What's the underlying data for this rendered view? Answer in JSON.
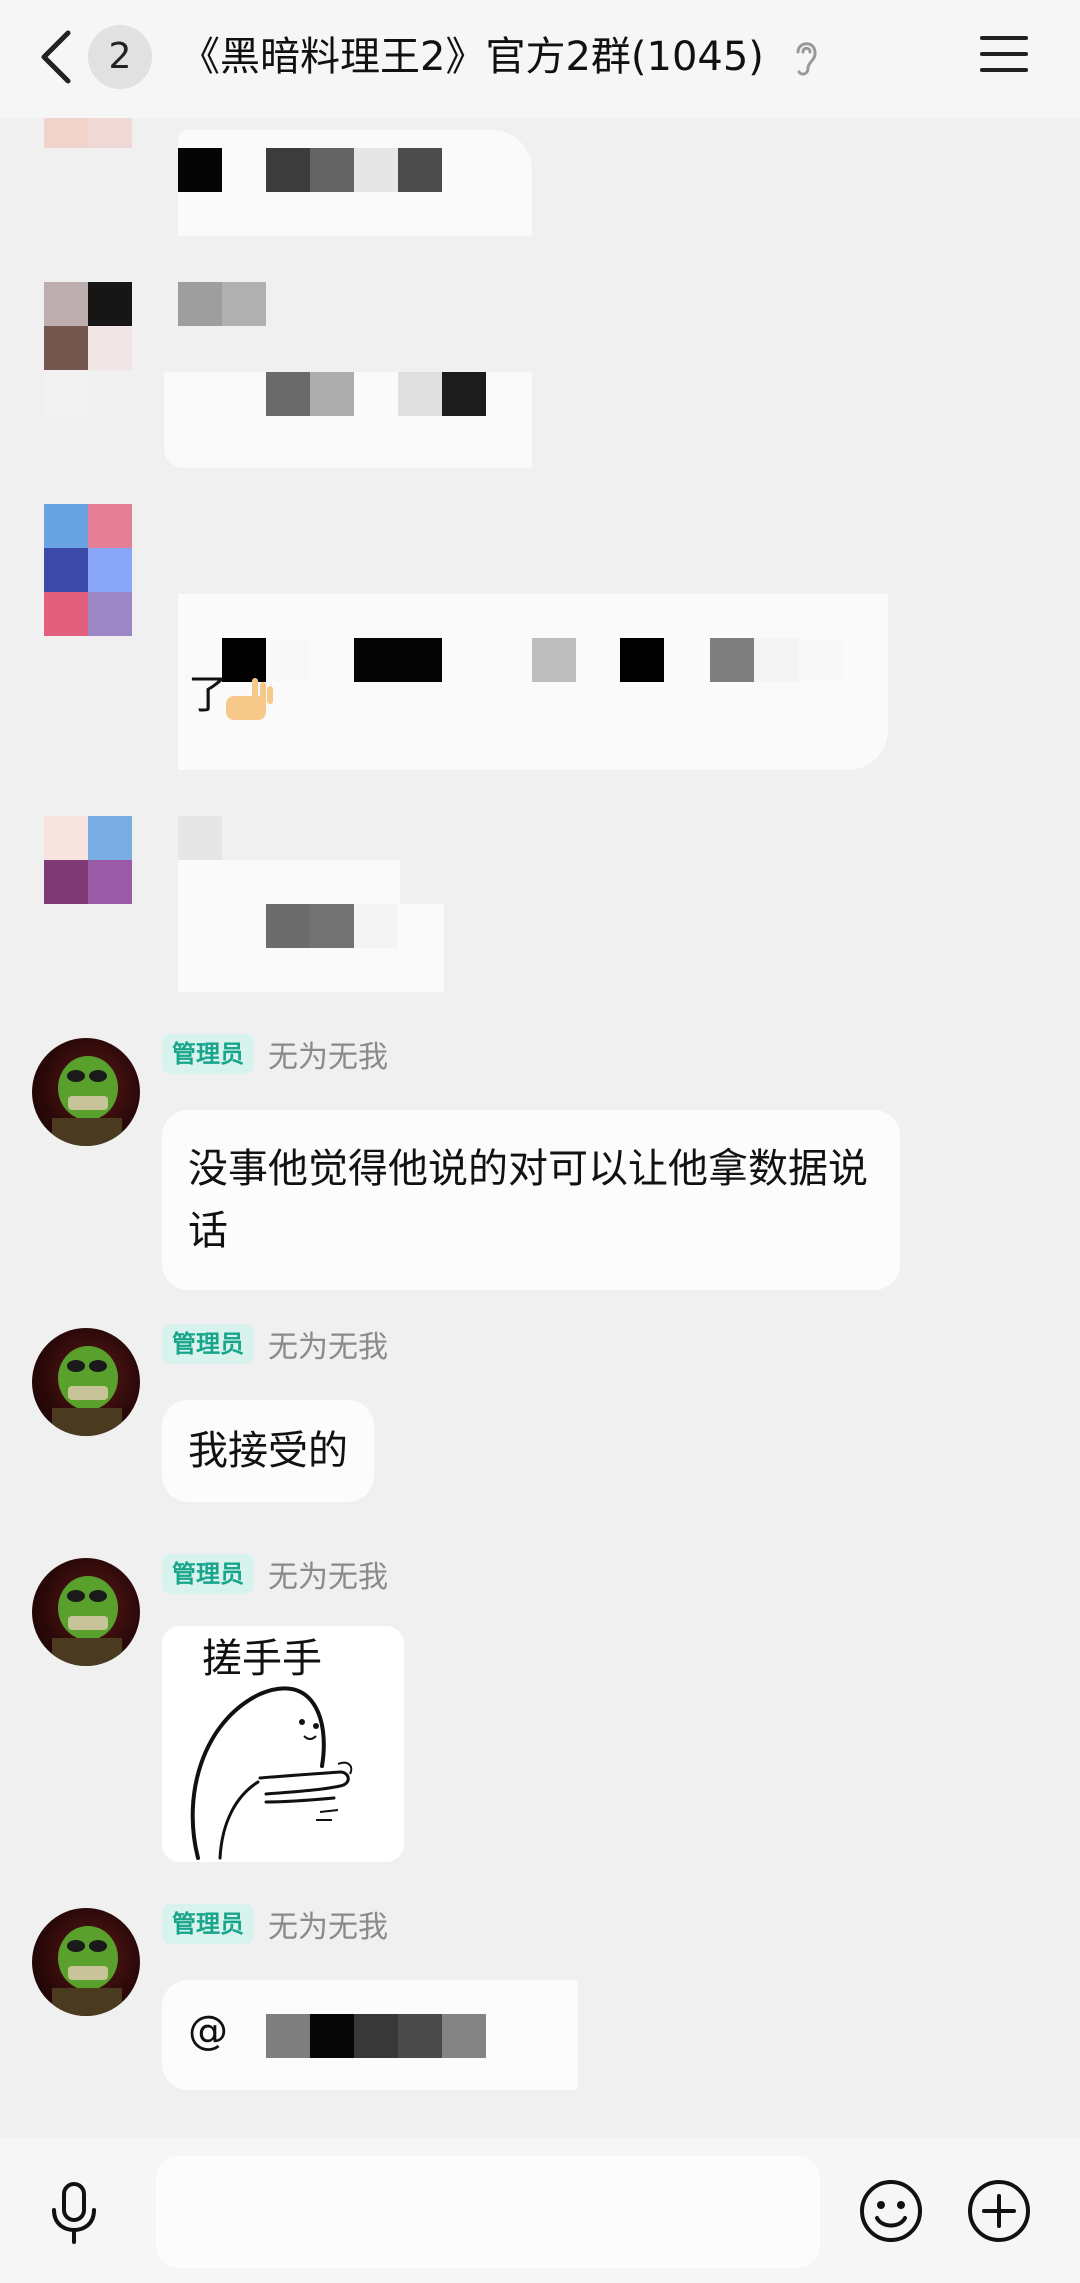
{
  "header": {
    "unread_count": "2",
    "title": "《黑暗料理王2》官方2群(1045)"
  },
  "messages": [
    {
      "admin_badge": "管理员",
      "sender": "无为无我",
      "text": "没事他觉得他说的对可以让他拿数据说话"
    },
    {
      "admin_badge": "管理员",
      "sender": "无为无我",
      "text": "我接受的"
    },
    {
      "admin_badge": "管理员",
      "sender": "无为无我",
      "sticker_text": "搓手手"
    },
    {
      "admin_badge": "管理员",
      "sender": "无为无我",
      "mention_prefix": "@"
    }
  ],
  "blurred": {
    "partial_text": "了"
  },
  "input": {
    "placeholder": ""
  },
  "icons": {
    "back": "chevron-left-icon",
    "ear": "ear-icon",
    "menu": "menu-icon",
    "mic": "microphone-icon",
    "emoji": "smiley-icon",
    "plus": "plus-circle-icon"
  }
}
